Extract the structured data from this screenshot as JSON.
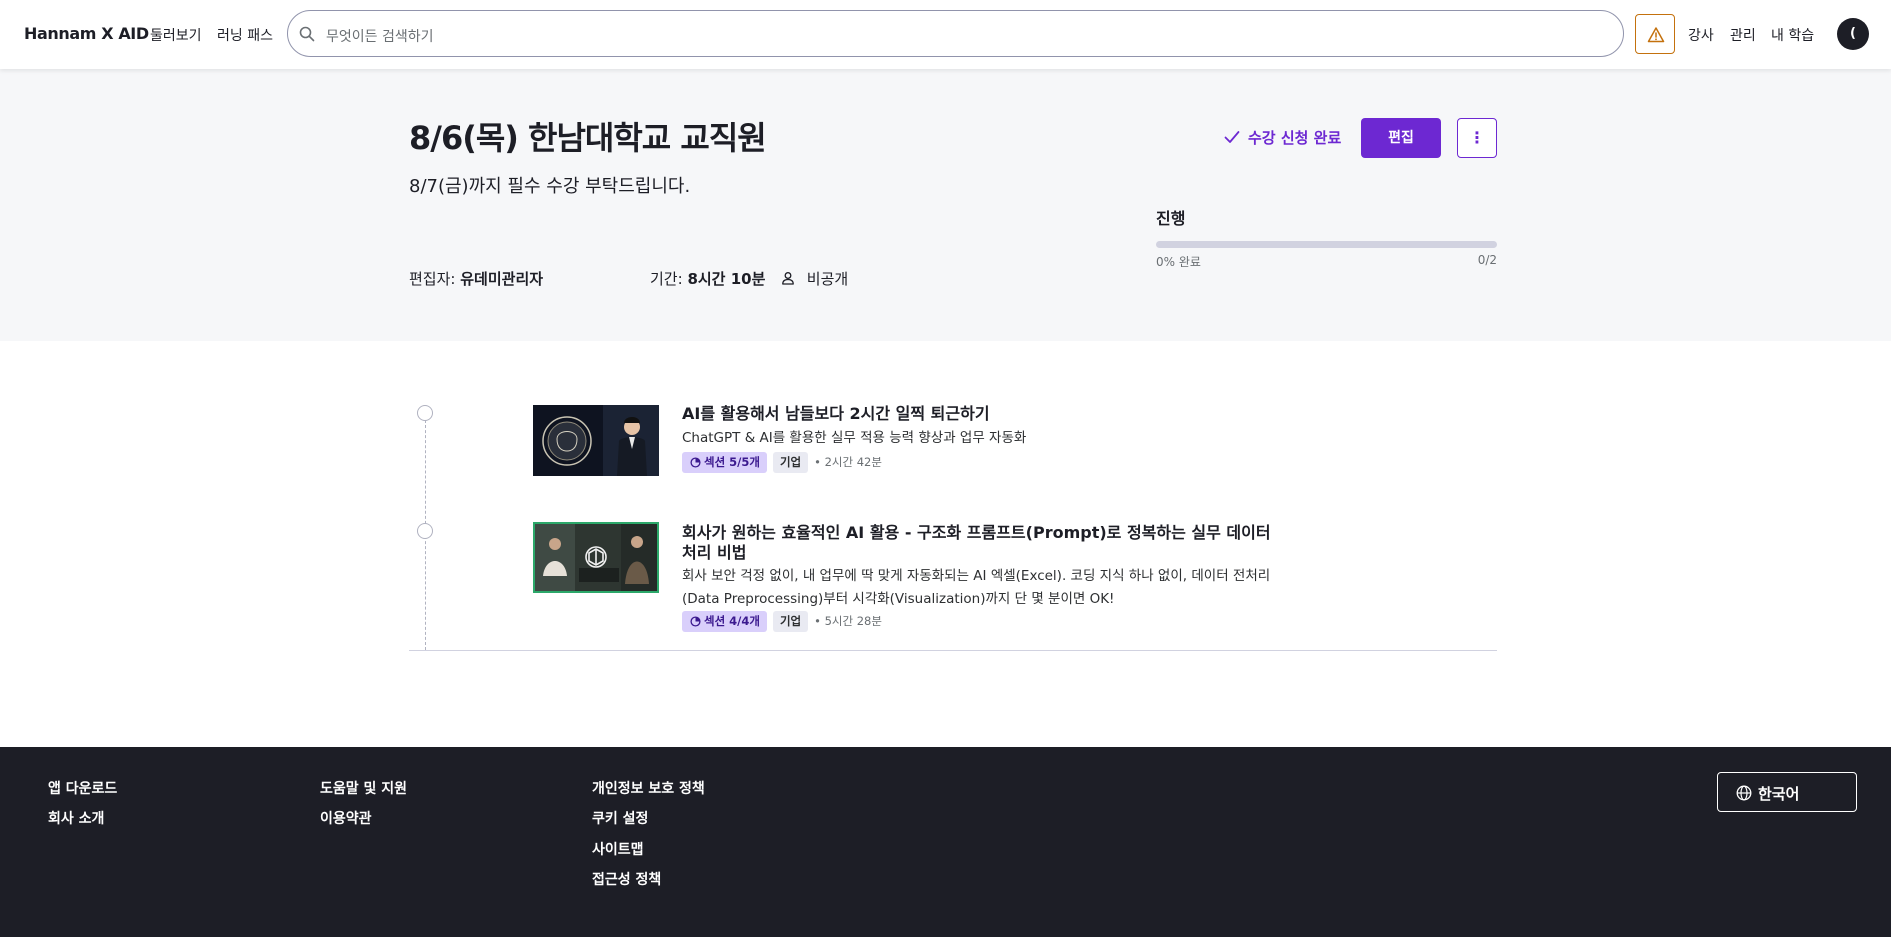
{
  "header": {
    "logo": "Hannam X AID",
    "nav": [
      "둘러보기",
      "러닝 패스"
    ],
    "search_placeholder": "무엇이든 검색하기",
    "right_links": [
      "강사",
      "관리",
      "내 학습"
    ],
    "avatar_initial": "("
  },
  "hero": {
    "title": "8/6(목) 한남대학교 교직원",
    "subtitle": "8/7(금)까지 필수 수강 부탁드립니다.",
    "editor_label": "편집자:",
    "editor_name": "유데미관리자",
    "duration_label": "기간:",
    "duration_value": "8시간 10분",
    "visibility": "비공개",
    "enrolled_label": "수강 신청 완료",
    "edit_button": "편집",
    "more_button": "⋮",
    "progress": {
      "label": "진행",
      "percent_text": "0% 완료",
      "count_text": "0/2",
      "fraction": 0
    }
  },
  "courses": [
    {
      "title": "AI를 활용해서 남들보다 2시간 일찍 퇴근하기",
      "description": "ChatGPT & AI를 활용한 실무 적용 능력 향상과 업무 자동화",
      "section_tag": "섹션 5/5개",
      "business_tag": "기업",
      "duration": "2시간 42분"
    },
    {
      "title": "회사가 원하는 효율적인 AI 활용 - 구조화 프롬프트(Prompt)로 정복하는 실무 데이터 처리 비법",
      "description": "회사 보안 걱정 없이, 내 업무에 딱 맞게 자동화되는 AI 엑셀(Excel). 코딩 지식 하나 없이, 데이터 전처리(Data Preprocessing)부터 시각화(Visualization)까지 단 몇 분이면 OK!",
      "section_tag": "섹션 4/4개",
      "business_tag": "기업",
      "duration": "5시간 28분"
    }
  ],
  "footer": {
    "col1": [
      "앱 다운로드",
      "회사 소개"
    ],
    "col2": [
      "도움말 및 지원",
      "이용약관"
    ],
    "col3": [
      "개인정보 보호 정책",
      "쿠키 설정",
      "사이트맵",
      "접근성 정책"
    ],
    "language": "한국어"
  },
  "colors": {
    "accent": "#6d28d2",
    "hero_bg": "#f6f7f9",
    "footer_bg": "#1d1e26",
    "section_tag_bg": "#d9cffb",
    "warning": "#c4710d"
  },
  "icons": [
    "search-icon",
    "warning-icon",
    "check-icon",
    "user-icon",
    "progress-icon",
    "globe-icon",
    "more-icon"
  ]
}
